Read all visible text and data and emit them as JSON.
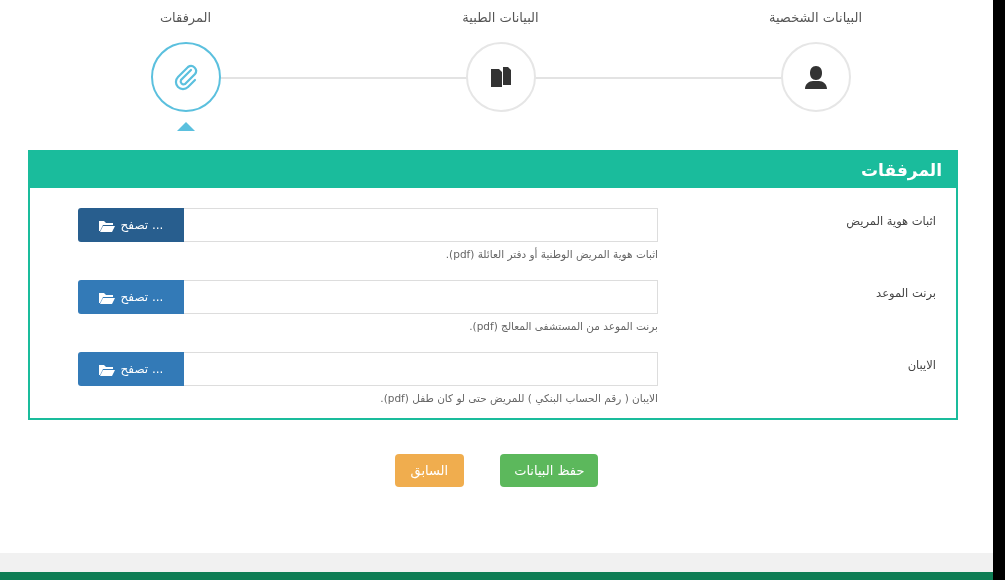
{
  "steps": [
    {
      "label": "البيانات الشخصية",
      "selected": false
    },
    {
      "label": "البيانات الطبية",
      "selected": false
    },
    {
      "label": "المرفقات",
      "selected": true
    }
  ],
  "panel": {
    "title": "المرفقات",
    "fields": [
      {
        "label": "اثبات هوية المريض",
        "button": "تصفح ...",
        "hovered": true,
        "help": "اثبات هوية المريض الوطنية أو دفتر العائلة (pdf)."
      },
      {
        "label": "برنت الموعد",
        "button": "تصفح ...",
        "hovered": false,
        "help": "برنت الموعد من المستشفى المعالج (pdf)."
      },
      {
        "label": "الايبان",
        "button": "تصفح ...",
        "hovered": false,
        "help": "الايبان ( رقم الحساب البنكي ) للمريض حتى لو كان طفل (pdf)."
      }
    ]
  },
  "actions": [
    {
      "label": "حفظ البيانات",
      "kind": "save"
    },
    {
      "label": "السابق",
      "kind": "back"
    }
  ]
}
